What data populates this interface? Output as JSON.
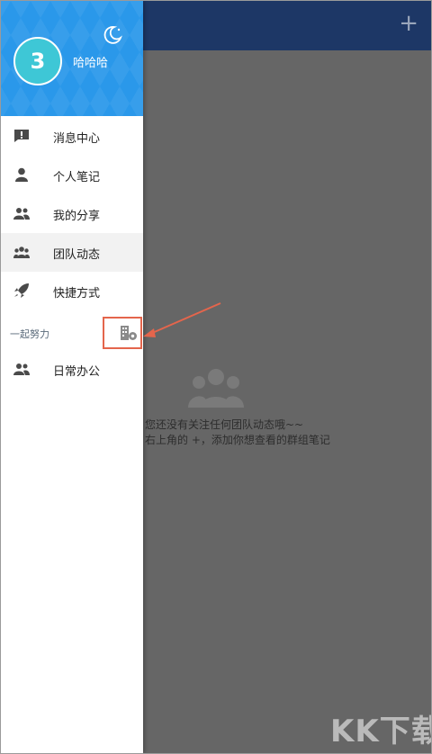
{
  "main": {
    "add_symbol": "+",
    "empty_line1": "您还没有关注任何团队动态哦~~",
    "empty_line2": "右上角的 +，添加你想查看的群组笔记"
  },
  "drawer": {
    "avatar_text": "3",
    "username": "哈哈哈",
    "menu": [
      {
        "label": "消息中心",
        "icon": "message-alert-icon"
      },
      {
        "label": "个人笔记",
        "icon": "person-icon"
      },
      {
        "label": "我的分享",
        "icon": "people-icon"
      },
      {
        "label": "团队动态",
        "icon": "team-icon"
      },
      {
        "label": "快捷方式",
        "icon": "rocket-icon"
      }
    ],
    "active_index": 3,
    "section_label": "一起努力",
    "group_item": "日常办公"
  },
  "watermark": "KK下载",
  "colors": {
    "header_blue": "#2a98ea",
    "toolbar_navy": "#1d3766",
    "avatar_teal": "#3ec7d6",
    "annotation_red": "#e4654c"
  }
}
